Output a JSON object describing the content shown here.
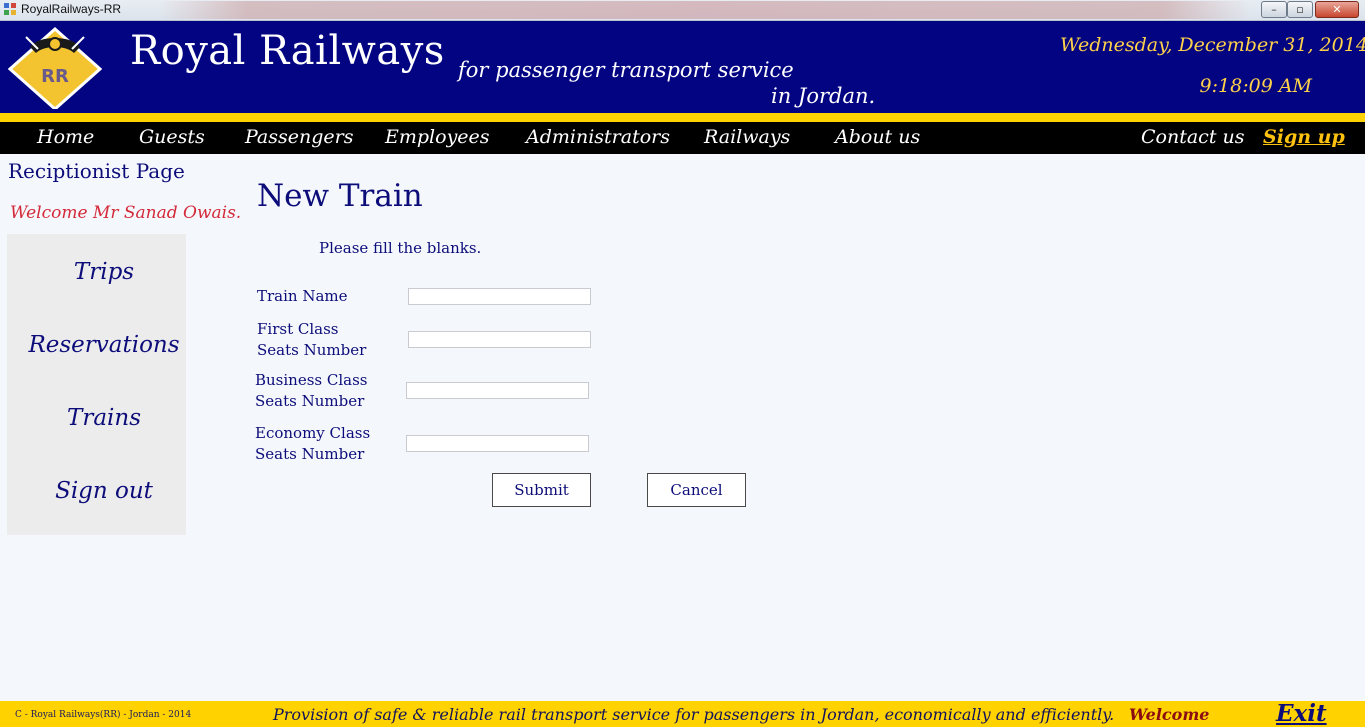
{
  "window": {
    "title": "RoyalRailways-RR",
    "min_label": "–",
    "max_label": "▫",
    "close_label": "✕"
  },
  "header": {
    "logo_text": "RR",
    "title": "Royal Railways",
    "tagline_line1": "for passenger transport service",
    "tagline_line2": "in Jordan.",
    "date": "Wednesday, December 31, 2014",
    "time": "9:18:09 AM"
  },
  "nav": {
    "home": "Home",
    "guests": "Guests",
    "passengers": "Passengers",
    "employees": "Employees",
    "administrators": "Administrators",
    "railways": "Railways",
    "about": "About us",
    "contact": "Contact us",
    "signup": "Sign up"
  },
  "sidebar": {
    "page_label": "Reciptionist Page",
    "welcome": "Welcome Mr Sanad Owais.",
    "links": [
      "Trips",
      "Reservations",
      "Trains",
      "Sign out"
    ]
  },
  "form": {
    "heading": "New Train",
    "instruction": "Please fill the blanks.",
    "fields": [
      {
        "line1": "Train Name",
        "line2": "",
        "value": ""
      },
      {
        "line1": "First Class",
        "line2": "Seats Number",
        "value": ""
      },
      {
        "line1": "Business Class",
        "line2": "Seats Number",
        "value": ""
      },
      {
        "line1": "Economy Class",
        "line2": "Seats Number",
        "value": ""
      }
    ],
    "submit_label": "Submit",
    "cancel_label": "Cancel"
  },
  "footer": {
    "copyright": "C - Royal Railways(RR) - Jordan - 2014",
    "slogan": "Provision of safe & reliable rail transport service for passengers in Jordan, economically and efficiently.",
    "welcome": "Welcome",
    "exit": "Exit"
  },
  "colors": {
    "header_bg": "#020482",
    "accent_yellow": "#ffd200",
    "nav_bg": "#000000",
    "text_navy": "#0d0d7a",
    "welcome_red": "#d42a3a",
    "footer_welcome": "#8b0d14"
  }
}
